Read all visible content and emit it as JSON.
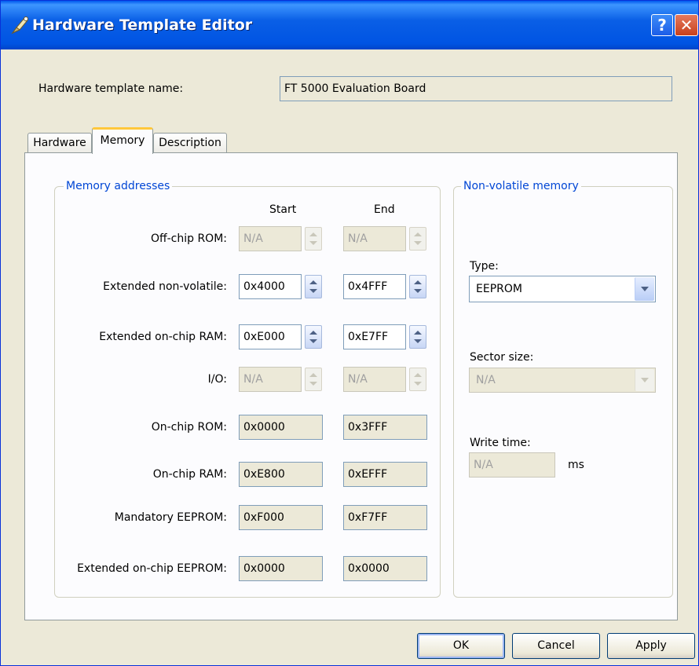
{
  "window": {
    "title": "Hardware Template Editor",
    "help_icon": "help-icon",
    "close_icon": "close-icon"
  },
  "template": {
    "name_label": "Hardware template name:",
    "name_value": "FT 5000 Evaluation Board"
  },
  "tabs": [
    {
      "label": "Hardware",
      "active": false
    },
    {
      "label": "Memory",
      "active": true
    },
    {
      "label": "Description",
      "active": false
    }
  ],
  "memory_addresses": {
    "group_title": "Memory addresses",
    "col_start": "Start",
    "col_end": "End",
    "rows": [
      {
        "label": "Off-chip ROM:",
        "start": "N/A",
        "end": "N/A",
        "spinner": true,
        "enabled": false
      },
      {
        "label": "Extended non-volatile:",
        "start": "0x4000",
        "end": "0x4FFF",
        "spinner": true,
        "enabled": true
      },
      {
        "label": "Extended on-chip RAM:",
        "start": "0xE000",
        "end": "0xE7FF",
        "spinner": true,
        "enabled": true
      },
      {
        "label": "I/O:",
        "start": "N/A",
        "end": "N/A",
        "spinner": true,
        "enabled": false
      },
      {
        "label": "On-chip ROM:",
        "start": "0x0000",
        "end": "0x3FFF",
        "spinner": false,
        "enabled": false
      },
      {
        "label": "On-chip RAM:",
        "start": "0xE800",
        "end": "0xEFFF",
        "spinner": false,
        "enabled": false
      },
      {
        "label": "Mandatory EEPROM:",
        "start": "0xF000",
        "end": "0xF7FF",
        "spinner": false,
        "enabled": false
      },
      {
        "label": "Extended on-chip EEPROM:",
        "start": "0x0000",
        "end": "0x0000",
        "spinner": false,
        "enabled": false
      }
    ]
  },
  "nonvolatile": {
    "group_title": "Non-volatile memory",
    "type_label": "Type:",
    "type_value": "EEPROM",
    "sector_label": "Sector size:",
    "sector_value": "N/A",
    "write_label": "Write time:",
    "write_value": "N/A",
    "write_unit": "ms"
  },
  "buttons": {
    "ok": "OK",
    "cancel": "Cancel",
    "apply": "Apply"
  }
}
